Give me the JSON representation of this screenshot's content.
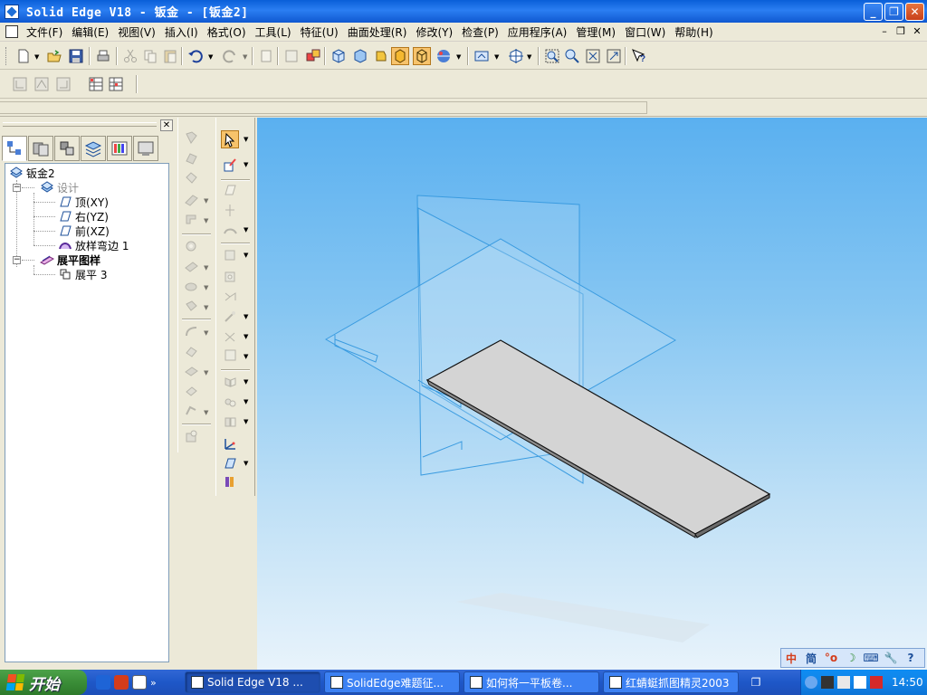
{
  "window": {
    "title": "Solid Edge V18 - 钣金 - [钣金2]"
  },
  "menu": [
    {
      "label": "文件(F)"
    },
    {
      "label": "编辑(E)"
    },
    {
      "label": "视图(V)"
    },
    {
      "label": "插入(I)"
    },
    {
      "label": "格式(O)"
    },
    {
      "label": "工具(L)"
    },
    {
      "label": "特征(U)"
    },
    {
      "label": "曲面处理(R)"
    },
    {
      "label": "修改(Y)"
    },
    {
      "label": "检查(P)"
    },
    {
      "label": "应用程序(A)"
    },
    {
      "label": "管理(M)"
    },
    {
      "label": "窗口(W)"
    },
    {
      "label": "帮助(H)"
    }
  ],
  "tree": {
    "root": "钣金2",
    "design": "设计",
    "planes": [
      "顶(XY)",
      "右(YZ)",
      "前(XZ)"
    ],
    "lofted_flange": "放样弯边 1",
    "flat_pattern": "展平图样",
    "flatten": "展平 3"
  },
  "taskbar": {
    "start": "开始",
    "tasks": [
      {
        "label": "Solid Edge V18 ...",
        "active": true
      },
      {
        "label": "SolidEdge难题征...",
        "active": false
      },
      {
        "label": "如何将一平板卷...",
        "active": false
      },
      {
        "label": "红蜻蜓抓图精灵2003",
        "active": false
      }
    ],
    "clock": "14:50"
  },
  "langbar": {
    "items": [
      "中",
      "简",
      "°o",
      "☽",
      "⌨",
      "🔧",
      "?"
    ]
  },
  "colors": {
    "titlebar": "#0a5fd8",
    "viewport_top": "#5ab0f0",
    "viewport_bottom": "#e8f3fb",
    "plane_line": "#3a9be0",
    "plate_fill": "#d4d4d4",
    "active_tool": "#f7c36b"
  }
}
